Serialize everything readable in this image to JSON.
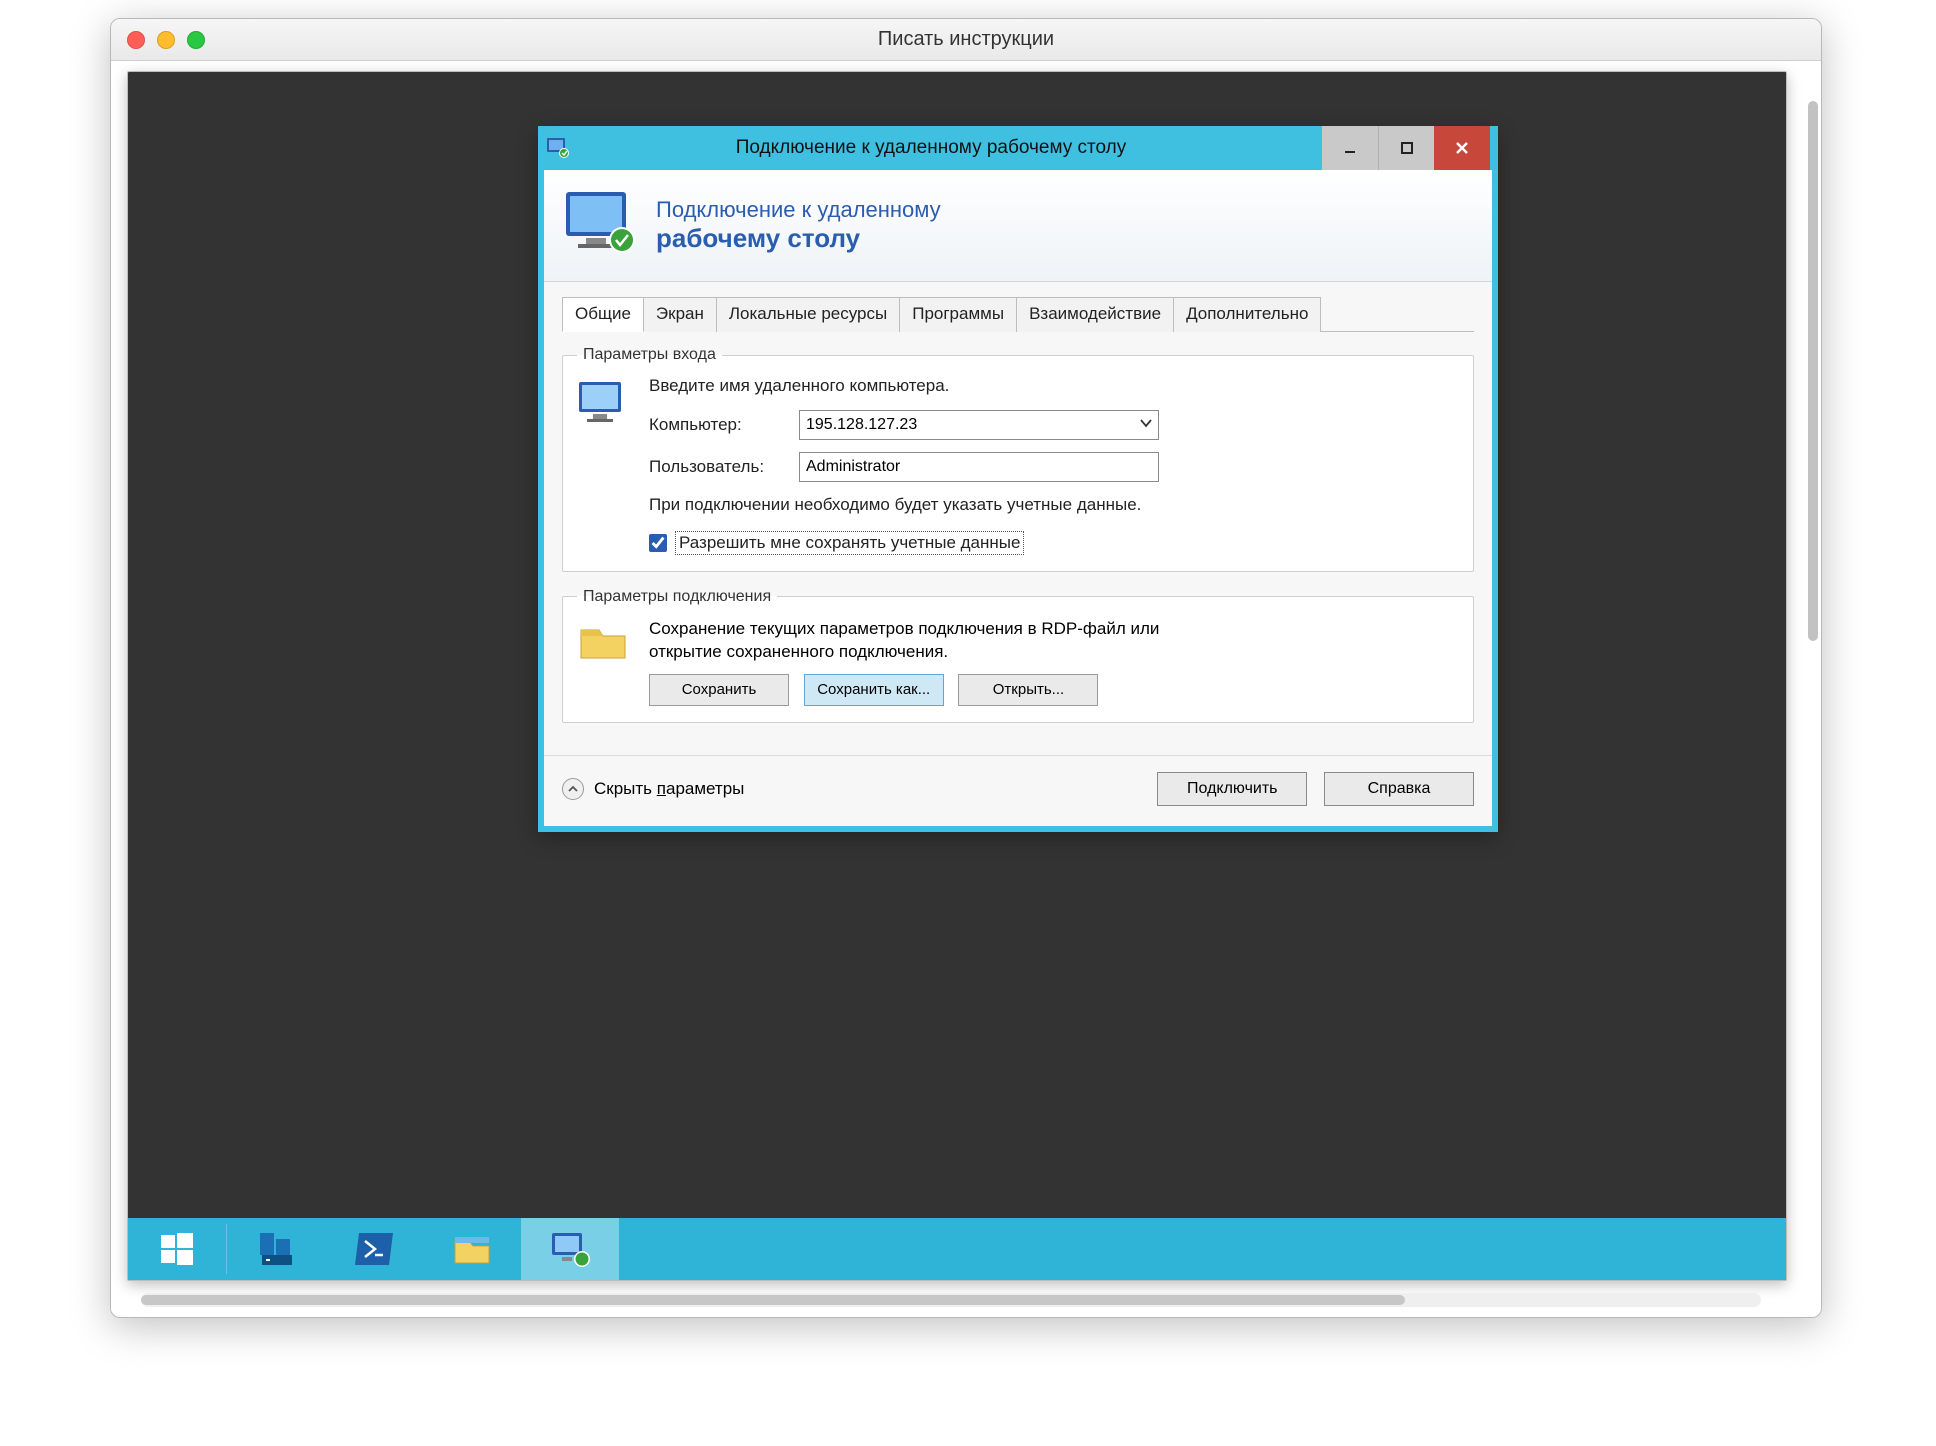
{
  "mac": {
    "title": "Писать инструкции"
  },
  "rdc": {
    "window_title": "Подключение к удаленному рабочему столу",
    "header_line1": "Подключение к удаленному",
    "header_line2": "рабочему столу",
    "tabs": [
      "Общие",
      "Экран",
      "Локальные ресурсы",
      "Программы",
      "Взаимодействие",
      "Дополнительно"
    ],
    "login": {
      "legend": "Параметры входа",
      "intro": "Введите имя удаленного компьютера.",
      "computer_label": "Компьютер:",
      "computer_value": "195.128.127.23",
      "user_label": "Пользователь:",
      "user_value": "Administrator",
      "note": "При подключении необходимо будет указать учетные данные.",
      "remember_checked": true,
      "remember_label": "Разрешить мне сохранять учетные данные"
    },
    "conn": {
      "legend": "Параметры подключения",
      "text": "Сохранение текущих параметров подключения в RDP-файл или открытие сохраненного подключения.",
      "save": "Сохранить",
      "save_as": "Сохранить как...",
      "open": "Открыть..."
    },
    "footer": {
      "collapse": "Скрыть параметры",
      "collapse_ul_char": "п",
      "connect": "Подключить",
      "help": "Справка"
    }
  }
}
